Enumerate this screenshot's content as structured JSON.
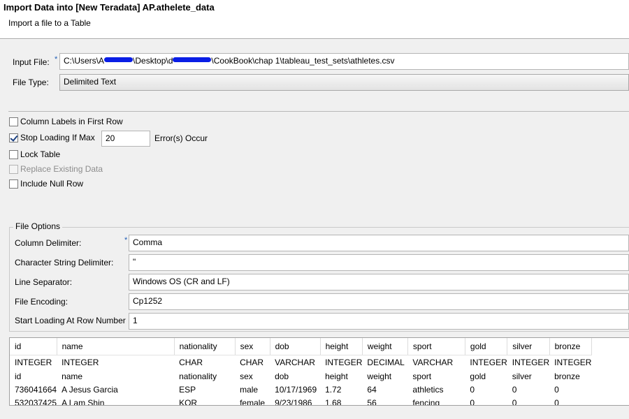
{
  "dialog": {
    "title": "Import Data into [New Teradata] AP.athelete_data",
    "subtitle": "Import a file to a Table"
  },
  "input_file": {
    "label": "Input File:",
    "required_mark": "*",
    "path_prefix": "C:\\Users\\A",
    "path_mid1": "\\Desktop\\d",
    "path_mid2": "\\CookBook\\chap 1\\tableau_test_sets\\athletes.csv"
  },
  "file_type": {
    "label": "File Type:",
    "value": "Delimited Text"
  },
  "options": {
    "column_labels": {
      "label": "Column Labels in First Row",
      "checked": false
    },
    "stop_loading": {
      "label": "Stop Loading If Max",
      "checked": true,
      "max_value": "20",
      "suffix": "Error(s) Occur"
    },
    "lock_table": {
      "label": "Lock Table",
      "checked": false
    },
    "replace_existing": {
      "label": "Replace Existing Data",
      "checked": false,
      "disabled": true
    },
    "include_null": {
      "label": "Include Null Row",
      "checked": false
    }
  },
  "file_options": {
    "title": "File Options",
    "column_delimiter": {
      "label": "Column Delimiter:",
      "required_mark": "*",
      "value": "Comma"
    },
    "string_delimiter": {
      "label": "Character String Delimiter:",
      "value": "\""
    },
    "line_separator": {
      "label": "Line Separator:",
      "value": "Windows OS (CR and LF)"
    },
    "file_encoding": {
      "label": "File Encoding:",
      "value": "Cp1252"
    },
    "start_row": {
      "label": "Start Loading At Row Number",
      "value": "1"
    }
  },
  "preview": {
    "columns": [
      "id",
      "name",
      "nationality",
      "sex",
      "dob",
      "height",
      "weight",
      "sport",
      "gold",
      "silver",
      "bronze"
    ],
    "rows": [
      [
        "INTEGER",
        "INTEGER",
        "CHAR",
        "CHAR",
        "VARCHAR",
        "INTEGER",
        "DECIMAL",
        "VARCHAR",
        "INTEGER",
        "INTEGER",
        "INTEGER"
      ],
      [
        "id",
        "name",
        "nationality",
        "sex",
        "dob",
        "height",
        "weight",
        "sport",
        "gold",
        "silver",
        "bronze"
      ],
      [
        "736041664",
        "A Jesus Garcia",
        "ESP",
        "male",
        "10/17/1969",
        "1.72",
        "64",
        "athletics",
        "0",
        "0",
        "0"
      ],
      [
        "532037425",
        "A Lam Shin",
        "KOR",
        "female",
        "9/23/1986",
        "1.68",
        "56",
        "fencing",
        "0",
        "0",
        "0"
      ]
    ]
  },
  "colors": {
    "redaction": "#0a1ee6",
    "required_mark": "#1c5ab4",
    "panel_bg": "#f0f0f0"
  }
}
